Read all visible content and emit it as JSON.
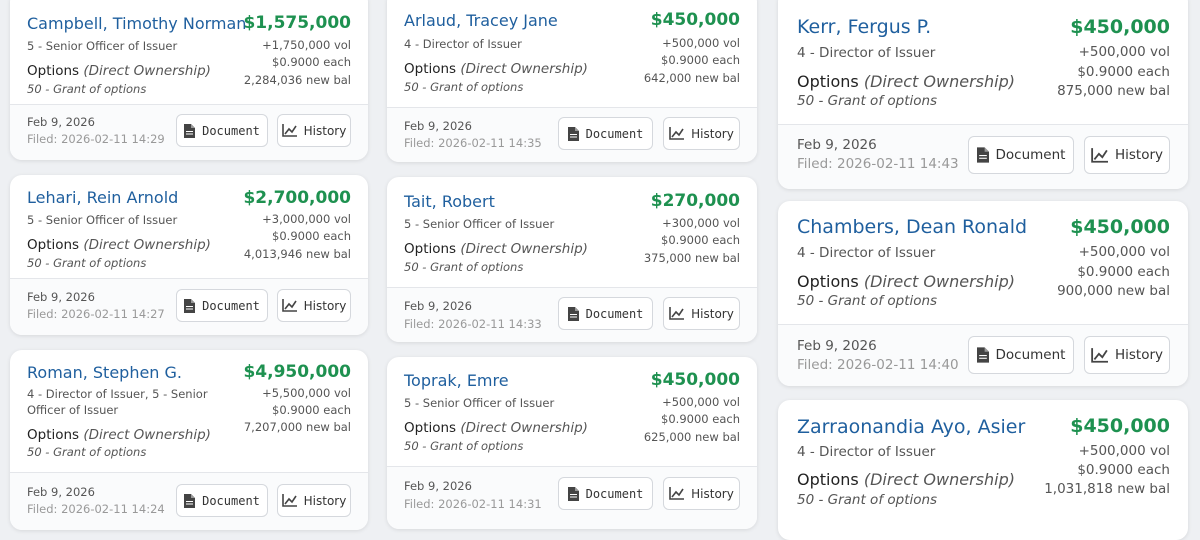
{
  "labels": {
    "security": "Options",
    "ownership": "(Direct Ownership)",
    "grant": "50 - Grant of options",
    "document": "Document",
    "history": "History",
    "date": "Feb 9, 2026"
  },
  "cards": [
    {
      "name": "Campbell, Timothy Norman",
      "amount": "$1,575,000",
      "role": "5 - Senior Officer of Issuer",
      "vol": "+1,750,000 vol",
      "price": "$0.9000 each",
      "bal": "2,284,036 new bal",
      "filed": "Filed: 2026-02-11 14:29"
    },
    {
      "name": "Lehari, Rein Arnold",
      "amount": "$2,700,000",
      "role": "5 - Senior Officer of Issuer",
      "vol": "+3,000,000 vol",
      "price": "$0.9000 each",
      "bal": "4,013,946 new bal",
      "filed": "Filed: 2026-02-11 14:27"
    },
    {
      "name": "Roman, Stephen G.",
      "amount": "$4,950,000",
      "role": "4 - Director of Issuer, 5 - Senior Officer of Issuer",
      "vol": "+5,500,000 vol",
      "price": "$0.9000 each",
      "bal": "7,207,000 new bal",
      "filed": "Filed: 2026-02-11 14:24"
    },
    {
      "name": "Arlaud, Tracey Jane",
      "amount": "$450,000",
      "role": "4 - Director of Issuer",
      "vol": "+500,000 vol",
      "price": "$0.9000 each",
      "bal": "642,000 new bal",
      "filed": "Filed: 2026-02-11 14:35"
    },
    {
      "name": "Tait, Robert",
      "amount": "$270,000",
      "role": "5 - Senior Officer of Issuer",
      "vol": "+300,000 vol",
      "price": "$0.9000 each",
      "bal": "375,000 new bal",
      "filed": "Filed: 2026-02-11 14:33"
    },
    {
      "name": "Toprak, Emre",
      "amount": "$450,000",
      "role": "5 - Senior Officer of Issuer",
      "vol": "+500,000 vol",
      "price": "$0.9000 each",
      "bal": "625,000 new bal",
      "filed": "Filed: 2026-02-11 14:31"
    },
    {
      "name": "Kerr, Fergus P.",
      "amount": "$450,000",
      "role": "4 - Director of Issuer",
      "vol": "+500,000 vol",
      "price": "$0.9000 each",
      "bal": "875,000 new bal",
      "filed": "Filed: 2026-02-11 14:43"
    },
    {
      "name": "Chambers, Dean Ronald",
      "amount": "$450,000",
      "role": "4 - Director of Issuer",
      "vol": "+500,000 vol",
      "price": "$0.9000 each",
      "bal": "900,000 new bal",
      "filed": "Filed: 2026-02-11 14:40"
    },
    {
      "name": "Zarraonandia Ayo, Asier",
      "amount": "$450,000",
      "role": "4 - Director of Issuer",
      "vol": "+500,000 vol",
      "price": "$0.9000 each",
      "bal": "1,031,818 new bal",
      "filed": ""
    }
  ]
}
